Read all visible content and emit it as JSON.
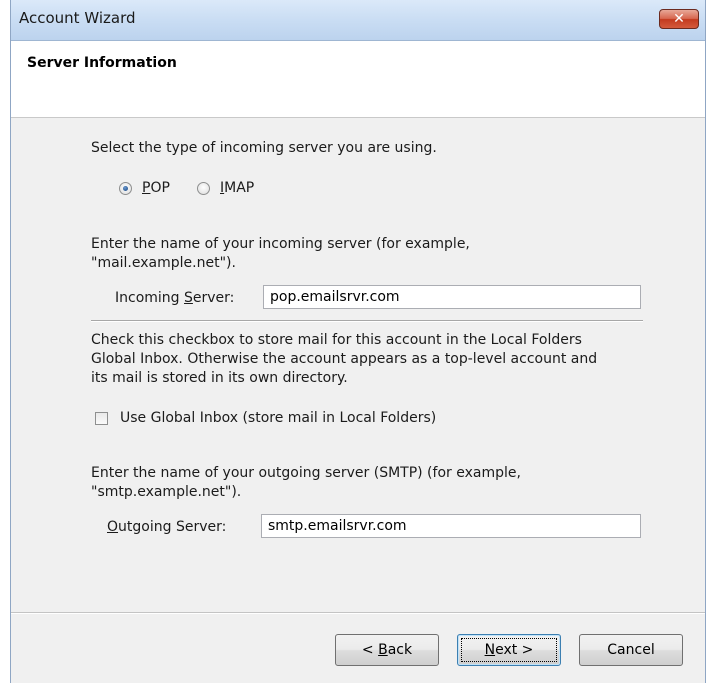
{
  "window": {
    "title": "Account Wizard",
    "close_glyph": "✕"
  },
  "header": {
    "title": "Server Information"
  },
  "server_type": {
    "prompt": "Select the type of incoming server you are using.",
    "options": [
      {
        "label_first": "P",
        "label_rest": "OP",
        "selected": true
      },
      {
        "label_first": "I",
        "label_rest": "MAP",
        "selected": false
      }
    ]
  },
  "incoming": {
    "line1": "Enter the name of your incoming server (for example,",
    "line2": "\"mail.example.net\").",
    "label_pre": "Incoming ",
    "label_mnemonic": "S",
    "label_post": "erver:",
    "value": "pop.emailsrvr.com"
  },
  "global_inbox": {
    "line1": "Check this checkbox to store mail for this account in the Local Folders",
    "line2": "Global Inbox. Otherwise the account appears as a top-level account and",
    "line3": "its mail is stored in its own directory.",
    "checkbox_label": "Use Global Inbox (store mail in Local Folders)",
    "checked": false
  },
  "outgoing": {
    "line1": "Enter the name of your outgoing server (SMTP) (for example,",
    "line2": "\"smtp.example.net\").",
    "label_mnemonic": "O",
    "label_post": "utgoing Server:",
    "value": "smtp.emailsrvr.com"
  },
  "buttons": {
    "back_pre": "< ",
    "back_mnemonic": "B",
    "back_post": "ack",
    "next_mnemonic": "N",
    "next_post": "ext >",
    "cancel": "Cancel"
  }
}
